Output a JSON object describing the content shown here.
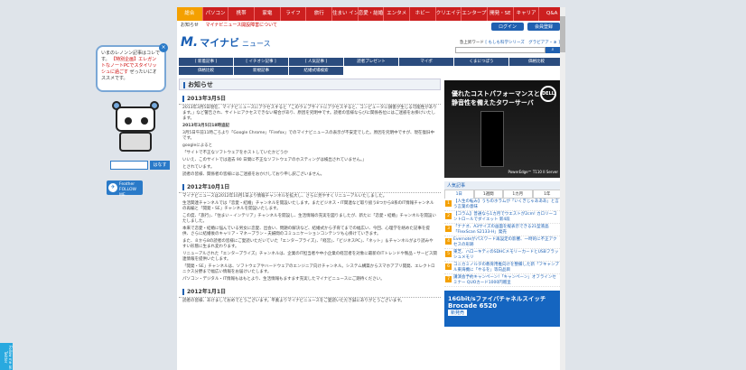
{
  "topnav": [
    "総合",
    "パソコン",
    "携帯",
    "家電",
    "ライフ",
    "旅行",
    "住まい インテリア",
    "恋愛・結婚",
    "エンタメ",
    "ホビー",
    "クリエイティブ",
    "エンタープライズ",
    "開発・SE",
    "キャリア",
    "Q&A"
  ],
  "notice": {
    "label": "お知らせ",
    "link": "マイナビニュース開設障害について"
  },
  "header": {
    "logo_mark": "M.",
    "logo_text": "マイナビ",
    "logo_sub": "ニュース",
    "login": "ログイン",
    "register": "会員登録",
    "keywords_label": "急上昇ワード",
    "keywords": "[ もしも科学シリーズ　グラビアア・ぁ ]",
    "search_button": "検索"
  },
  "catnav": [
    "[ 新着記事 ]",
    "[ イチオシ記事 ]",
    "[ 人気記事 ]",
    "読者プレゼント",
    "マイポ",
    "くまにつぽう",
    "価格比較",
    "価格比較",
    "新規記事",
    "結婚式場検索"
  ],
  "main": {
    "title": "お知らせ",
    "posts": [
      {
        "date": "2013年3月5日",
        "paras": [
          "2013年3月5日現在、マイナビニュースにアクセスすると「このウェブサイトにアクセスすると、コンピュータに損害が生じる可能性があります。」など警告され、サイトにアクセスできない場合があり、原因を究明中です。読者の皆様ならびに関係各位にはご迷惑をお掛けいたします。",
          "2013年3月5日18時追記",
          "3月5日午前11時ごろより「Google Chrome」「Firefox」でのマイナビニュースの表示が不安定でした。原因を究明中ですが、現在復旧中です。",
          "googleによると",
          "「サイトで不正なソフトウェアをホストしていたかどうか",
          "いいえ、このサイトでは過去 90 日間に不正なソフトウェアのホスティングは検出されていません。」",
          "とされています。",
          "読者の皆様、関係者の皆様にはご迷惑をおかけしており申し訳ございません。"
        ]
      },
      {
        "date": "2012年10月1日",
        "paras": [
          "マイナビニュースは2012年10月1日より情報チャンネルを拡大し、さらに見やすくリニューアルいたしました。",
          "生活関連チャンネルでは「恋愛・結婚」チャンネルを開設いたします。またビジネス・IT関連など取り扱う8つから8系のIT情報チャンネルの再編と「開発・SE」チャンネルを開設いたします。",
          "この度、「旅行」、「住まい・インテリア」チャンネルを開設し、生活情報の充実を図りましたが、新たに「恋愛・結婚」チャンネルを開設いたしました。",
          "本来で恋愛・結婚に悩んでいる男女に恋愛、出会い、問題の解決など、結婚式から子育てまでの幅広い、今回、心理学を絡めた記事を提供、さらに結婚後のキャリア・マネープラン・夫婦間のコミュニケーションコンテンツも心掛けていきます。",
          "また、８から8の読者の皆様にご愛読いただいていた「エンタープライズ」、「経営」、「ビジネスPC」、「ネット」＆チャンネルがより読みやすい形態に生まれ変わります。",
          "リニューアルされた「エンタープライズ」チャンネルは、企業のIT担当者や中小企業の経営者を対象に最新のITトレンドや製品・サービス関連情報を提供いたします。",
          "「開発・SE」チャンネルは、ソフトウェアやハードウェアのエンジニア向けチャンネル。システム構築からスマホアプリ開発、エレクトロニクス分野まで幅広い情報をお届けいたします。",
          "パソコン・デジタル・IT情報もはもとより、生活情報もますます充実したマイナビニュースにご期待ください。"
        ]
      },
      {
        "date": "2012年1月1日",
        "paras": [
          "読者の皆様、あけましておめでとうございます。平素よりマイナビニュースをご愛読いただき誠にありがとうございます。"
        ]
      }
    ]
  },
  "side": {
    "ad1": {
      "line1": "優れたコストパフォーマンスと",
      "line2": "静音性を備えたタワーサーバ",
      "brand": "DELL",
      "caption": "PowerEdge™ T110 II Server"
    },
    "rank_title": "人気記事",
    "rank_tabs": [
      "1日",
      "1週間",
      "1カ月",
      "1年"
    ],
    "rank": [
      "【人生の転み】うちのホラムが「いくぎじゃあああ」と言う言葉の意味",
      "【コラム】普通なら1カ月でウエストが2cm! カロリーコントロールでダイエット 新4段",
      "「ナナオ、A3サイズの画面を縦表示できる21型液晶「FlexScan S2133-H」発売",
      "Evernoteがパスワード再設定の影響、一時的に不正アクセスの形跡",
      "東芝、ハローキティのSDHCメモリーカードとUSBフラッシュメモリ",
      "コニカミノルタの教育用推向けを整備した新「フキャンプル東海機に「やるを」等向品目",
      "講演会予約キャンペーン!「キャンペーン」オフラインセミナー QUOカード1000円贈呈"
    ],
    "ad2": {
      "a": "16Gbit/sファイバチャネルスイッチ",
      "b": "Brocade 6520",
      "c": "新発売"
    }
  },
  "widget": {
    "text": "いまのレノンン記事はコレです。",
    "link": "【特別企画】エレガントなノートPCでスタイリッシュに過ごす",
    "tail": "ぜったいにオススメです。",
    "close": "×",
    "search_button": "はなす",
    "feather_label": "Feather FOLLOW ME",
    "follow_label": "Follow me on Twitter"
  }
}
